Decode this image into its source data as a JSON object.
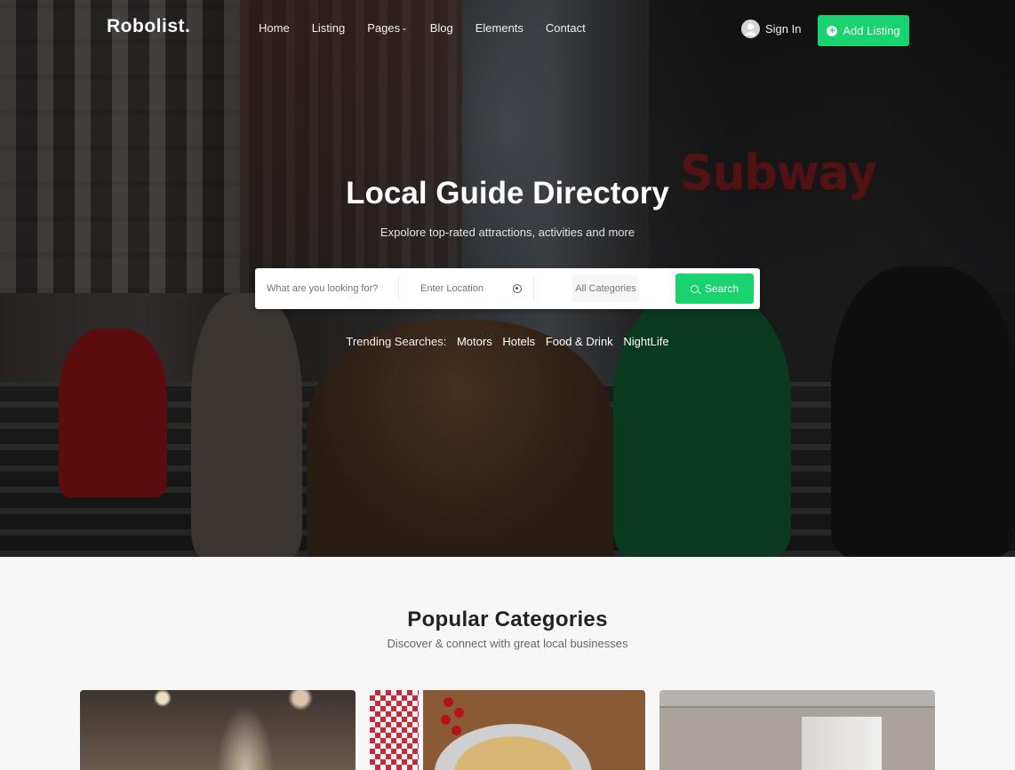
{
  "brand": {
    "logo": "Robolist.",
    "accent_color": "#19d36e"
  },
  "nav": {
    "items": [
      {
        "label": "Home"
      },
      {
        "label": "Listing"
      },
      {
        "label": "Pages",
        "has_dropdown": true
      },
      {
        "label": "Blog"
      },
      {
        "label": "Elements"
      },
      {
        "label": "Contact"
      }
    ],
    "dropdown_icon": "chevron-down-icon",
    "sign_in": "Sign In",
    "sign_in_icon": "user-icon",
    "add_listing": "Add Listing",
    "add_listing_icon": "plus-circle-icon"
  },
  "hero": {
    "title": "Local Guide Directory",
    "subtitle": "Expolore top-rated attractions, activities and more",
    "background_text": "Subway",
    "search": {
      "what_placeholder": "What are you looking for?",
      "location_placeholder": "Enter Location",
      "location_icon": "target-icon",
      "category_selected": "All Categories",
      "button_label": "Search",
      "button_icon": "search-icon"
    },
    "trending": {
      "label": "Trending Searches:",
      "items": [
        "Motors",
        "Hotels",
        "Food & Drink",
        "NightLife"
      ]
    }
  },
  "categories_section": {
    "title": "Popular Categories",
    "subtitle": "Discover & connect with great local businesses",
    "cards": [
      {
        "image": "car-lights-night"
      },
      {
        "image": "pizza-food"
      },
      {
        "image": "hotel-room"
      }
    ]
  }
}
